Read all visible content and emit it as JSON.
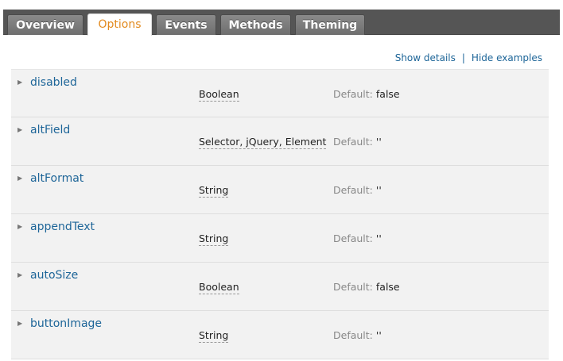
{
  "tabs": [
    {
      "label": "Overview",
      "active": false
    },
    {
      "label": "Options",
      "active": true
    },
    {
      "label": "Events",
      "active": false
    },
    {
      "label": "Methods",
      "active": false
    },
    {
      "label": "Theming",
      "active": false
    }
  ],
  "links": {
    "show_details": "Show details",
    "separator": "|",
    "hide_examples": "Hide examples"
  },
  "default_label": "Default:",
  "options": [
    {
      "name": "disabled",
      "type": "Boolean",
      "default": "false"
    },
    {
      "name": "altField",
      "type": "Selector, jQuery, Element",
      "default": "''"
    },
    {
      "name": "altFormat",
      "type": "String",
      "default": "''"
    },
    {
      "name": "appendText",
      "type": "String",
      "default": "''"
    },
    {
      "name": "autoSize",
      "type": "Boolean",
      "default": "false"
    },
    {
      "name": "buttonImage",
      "type": "String",
      "default": "''"
    }
  ],
  "icons": {
    "expand": "triangle-right-icon"
  },
  "colors": {
    "tabbar_bg": "#555555",
    "active_tab_text": "#e28a1e",
    "link": "#1d6598",
    "row_bg": "#f2f2f2"
  }
}
